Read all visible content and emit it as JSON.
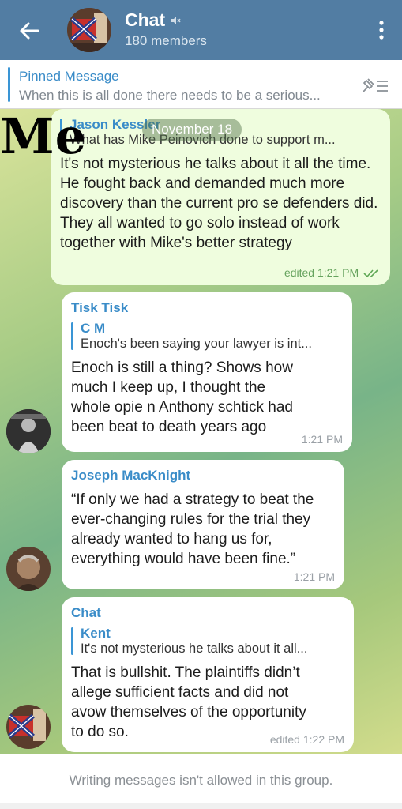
{
  "header": {
    "title": "Chat",
    "members": "180 members"
  },
  "pinned": {
    "title": "Pinned Message",
    "text": "When this is all done there needs to be a serious..."
  },
  "overlay": {
    "me_label": "Me",
    "date": "November 18"
  },
  "messages": [
    {
      "reply_name": "Jason Kessler",
      "reply_text": "What has Mike Peinovich done to support m...",
      "text": "It's not mysterious he talks about it all the time. He fought back and demanded much more discovery than the current pro se defenders did. They all wanted to go solo instead of work together with Mike's better strategy",
      "meta": "edited 1:21 PM"
    },
    {
      "sender": "Tisk Tisk",
      "reply_name": "C M",
      "reply_text": "Enoch's been saying your lawyer is int...",
      "text": "Enoch is still a thing?  Shows how much I keep up, I thought the whole opie n Anthony schtick had been beat to death years ago",
      "meta": "1:21 PM"
    },
    {
      "sender": "Joseph MacKnight",
      "text": "“If only we had a strategy to beat the ever-changing rules for the trial they already wanted to hang us for, everything would have been fine.”",
      "meta": "1:21 PM"
    },
    {
      "sender": "Chat",
      "reply_name": "Kent",
      "reply_text": "It's not mysterious he talks about it all...",
      "text": "That is bullshit. The plaintiffs didn’t allege sufficient facts and did not avow themselves of the opportunity to do so.",
      "meta": "edited 1:22 PM"
    }
  ],
  "footer": {
    "text": "Writing messages isn't allowed in this group."
  },
  "colors": {
    "header": "#527da3",
    "accent": "#3a8cc8",
    "outgoing_bubble": "#effdde"
  }
}
